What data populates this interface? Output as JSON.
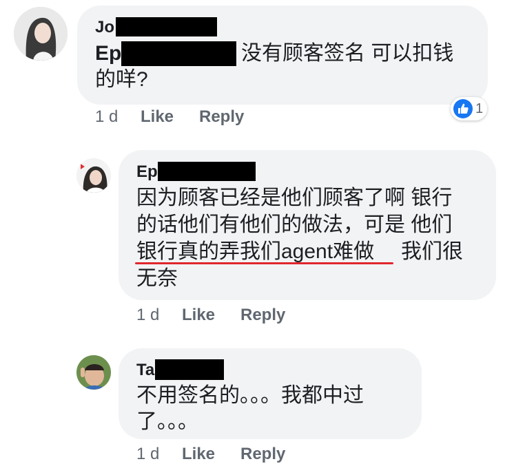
{
  "colors": {
    "bubble": "#f2f3f5",
    "meta_text": "#606770",
    "like_blue": "#1877f2",
    "underline_red": "#e0262c",
    "redaction": "#000000"
  },
  "comments": [
    {
      "author_prefix": "Jo",
      "mention_prefix": "Ep",
      "lines": [
        "没有顾客签名 可以扣钱",
        "的咩?"
      ],
      "time": "1 d",
      "like_label": "Like",
      "reply_label": "Reply",
      "reaction": {
        "icon": "thumbs-up-icon",
        "count": "1"
      }
    },
    {
      "author_prefix": "Ep",
      "lines": [
        "因为顾客已经是他们顾客了啊 银行",
        "的话他们有他们的做法，可是 他们",
        "银行真的弄我们agent难做",
        "我们很",
        "无奈"
      ],
      "time": "1 d",
      "like_label": "Like",
      "reply_label": "Reply"
    },
    {
      "author_prefix": "Ta",
      "lines": [
        "不用签名的。。。我都中过",
        "了。。。"
      ],
      "time": "1 d",
      "like_label": "Like",
      "reply_label": "Reply"
    }
  ]
}
